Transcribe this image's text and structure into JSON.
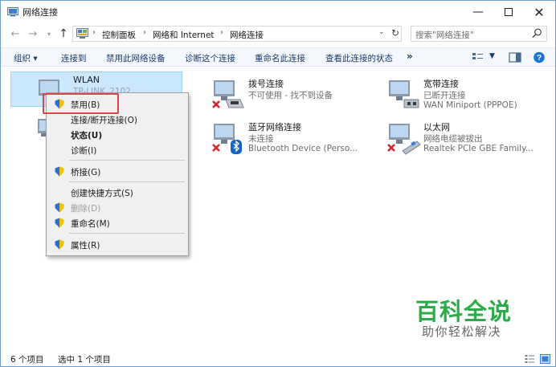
{
  "window": {
    "title": "网络连接"
  },
  "address": {
    "crumbs": [
      "控制面板",
      "网络和 Internet",
      "网络连接"
    ],
    "search_placeholder": "搜索\"网络连接\""
  },
  "toolbar": {
    "organize": "组织 ▾",
    "connect_to": "连接到",
    "disable": "禁用此网络设备",
    "diagnose": "诊断这个连接",
    "rename": "重命名此连接",
    "view_status": "查看此连接的状态",
    "more": "»"
  },
  "connections": [
    {
      "name": "WLAN",
      "status": "TP-LINK_2102",
      "device": ""
    },
    {
      "name": "拨号连接",
      "status": "不可使用 - 找不到设备",
      "device": ""
    },
    {
      "name": "宽带连接",
      "status": "已断开连接",
      "device": "WAN Miniport (PPPOE)"
    },
    {
      "name": "蓝牙网络连接",
      "status": "未连接",
      "device": "Bluetooth Device (Perso..."
    },
    {
      "name": "以太网",
      "status": "网络电缆被拔出",
      "device": "Realtek PCIe GBE Family..."
    }
  ],
  "context_menu": {
    "items": [
      {
        "label": "禁用(B)",
        "shield": true,
        "bold": false,
        "disabled": false
      },
      {
        "label": "连接/断开连接(O)",
        "shield": false,
        "bold": false,
        "disabled": false
      },
      {
        "label": "状态(U)",
        "shield": false,
        "bold": true,
        "disabled": false
      },
      {
        "label": "诊断(I)",
        "shield": false,
        "bold": false,
        "disabled": false
      },
      {
        "label": "桥接(G)",
        "shield": true,
        "bold": false,
        "disabled": false
      },
      {
        "label": "创建快捷方式(S)",
        "shield": false,
        "bold": false,
        "disabled": false
      },
      {
        "label": "删除(D)",
        "shield": true,
        "bold": false,
        "disabled": true
      },
      {
        "label": "重命名(M)",
        "shield": true,
        "bold": false,
        "disabled": false
      },
      {
        "label": "属性(R)",
        "shield": true,
        "bold": false,
        "disabled": false
      }
    ]
  },
  "status_bar": {
    "count": "6 个项目",
    "selected": "选中 1 个项目"
  },
  "watermark": {
    "title": "百科全说",
    "subtitle": "助你轻松解决"
  },
  "colors": {
    "accent": "#1a3a6a",
    "selection": "#cce8ff",
    "highlight": "#e0444b",
    "watermark": "#2cab4a"
  }
}
